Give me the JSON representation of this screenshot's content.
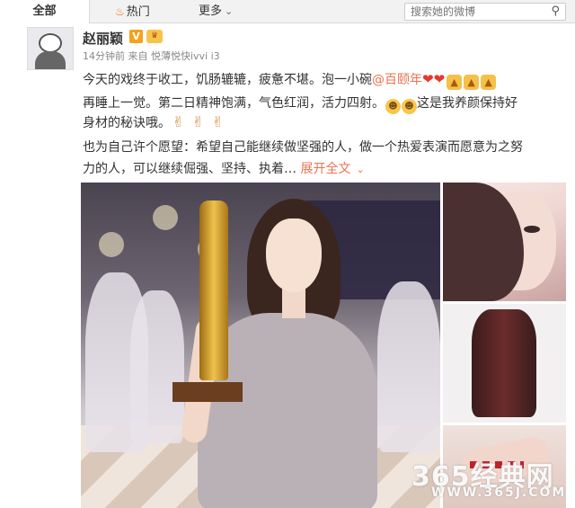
{
  "tabs": {
    "all": "全部",
    "hot": "热门",
    "more": "更多"
  },
  "search": {
    "placeholder": "搜索她的微博"
  },
  "post": {
    "author": "赵丽颖",
    "verified_badge": "V",
    "meta": "14分钟前 来自 悦薄悦快ivvi i3",
    "line1_prefix": "今天的戏终于收工，饥肠辘辘，疲惫不堪。泡一小碗",
    "mention": "@百颐年",
    "line2_text": "再睡上一觉。第二日精神饱满，气色红润，活力四射。",
    "line2_suffix": "这是我养颜保持好",
    "line3_text": "身材的秘诀哦。",
    "line4_text": "也为自己许个愿望：希望自己能继续做坚强的人，做一个热爱表演而愿意为之努",
    "line5_text": "力的人，可以继续倔强、坚持、执着…",
    "expand_label": "展开全文"
  },
  "watermark": {
    "brand": "365经典网",
    "url": "WWW.365J.COM"
  },
  "colors": {
    "accent": "#eb7350",
    "tab_bg": "#f2f2f2",
    "heart": "#e8372c"
  },
  "icons": [
    "fire-icon",
    "chevron-down-icon",
    "search-icon",
    "verified-icon",
    "vip-icon",
    "heart-icon",
    "thumbs-up-icon",
    "laughing-face-icon",
    "victory-hand-icon"
  ]
}
